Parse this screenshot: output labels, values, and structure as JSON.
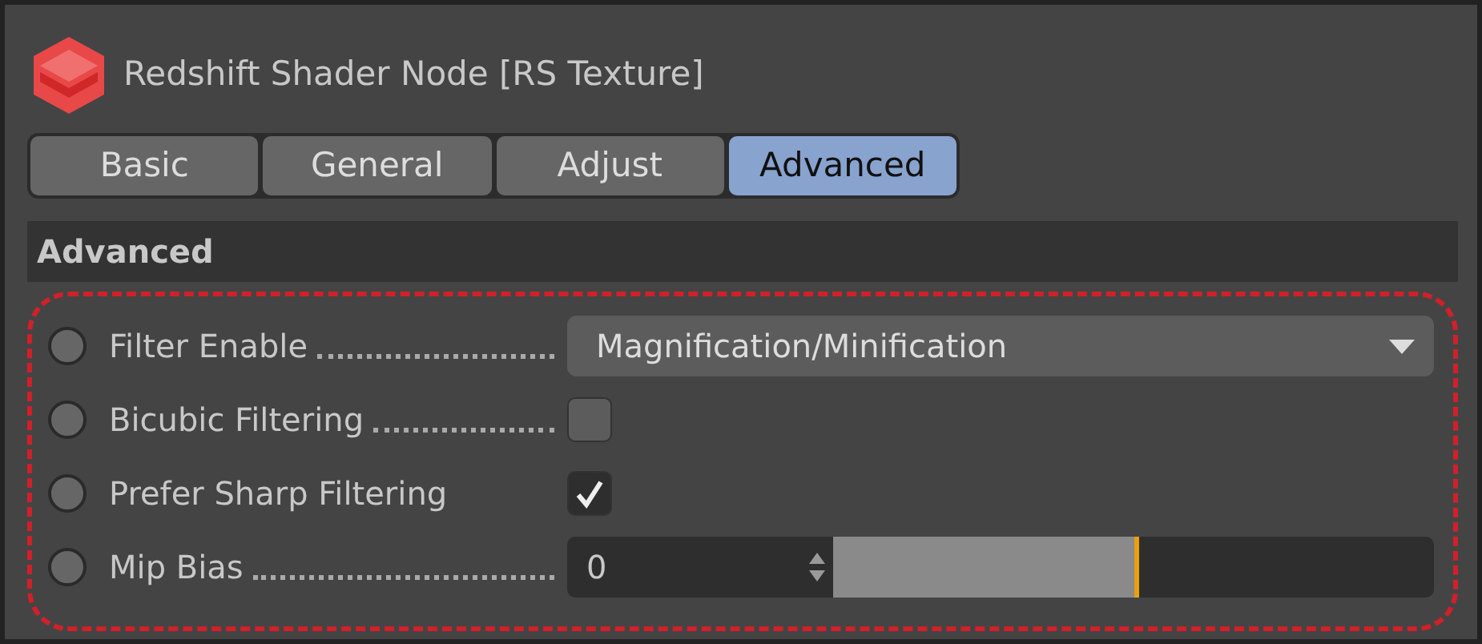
{
  "window": {
    "title": "Redshift Shader Node [RS Texture]"
  },
  "tabs": [
    {
      "label": "Basic",
      "selected": false
    },
    {
      "label": "General",
      "selected": false
    },
    {
      "label": "Adjust",
      "selected": false
    },
    {
      "label": "Advanced",
      "selected": true
    }
  ],
  "section": {
    "title": "Advanced"
  },
  "highlight": {
    "color": "#d0202a"
  },
  "parameters": [
    {
      "kind": "dropdown",
      "label": "Filter Enable",
      "value": "Magnification/Minification"
    },
    {
      "kind": "checkbox",
      "label": "Bicubic Filtering",
      "checked": false
    },
    {
      "kind": "checkbox",
      "label": "Prefer Sharp Filtering",
      "checked": true
    },
    {
      "kind": "slider",
      "label": "Mip Bias",
      "value": "0",
      "level": 0.51
    }
  ]
}
